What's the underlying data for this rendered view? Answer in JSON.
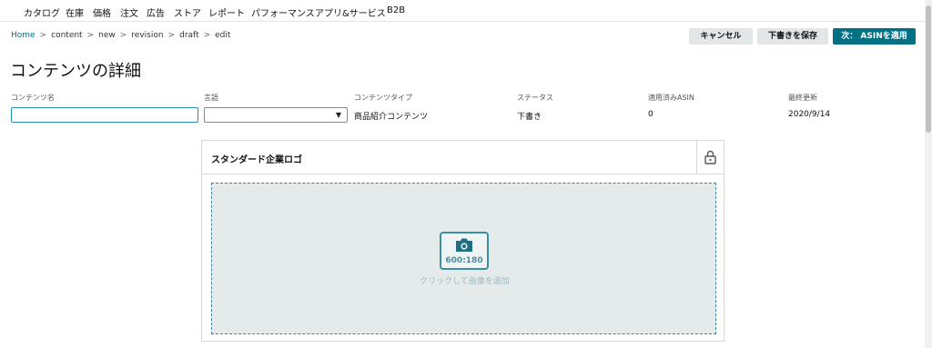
{
  "topnav": {
    "items": [
      "カタログ",
      "在庫",
      "価格",
      "注文",
      "広告",
      "ストア",
      "レポート",
      "パフォーマンス",
      "アプリ&サービス",
      "B2B"
    ]
  },
  "breadcrumb": {
    "items": [
      "Home",
      "content",
      "new",
      "revision",
      "draft",
      "edit"
    ],
    "separator": ">"
  },
  "actions": {
    "cancel": "キャンセル",
    "save_draft": "下書きを保存",
    "next": "次： ASINを適用"
  },
  "page_title": "コンテンツの詳細",
  "fields": {
    "content_name": {
      "label": "コンテンツ名",
      "value": "",
      "placeholder": ""
    },
    "language": {
      "label": "言語",
      "value": ""
    },
    "content_type": {
      "label": "コンテンツタイプ",
      "value": "商品紹介コンテンツ"
    },
    "status": {
      "label": "ステータス",
      "value": "下書き"
    },
    "applied_asin": {
      "label": "適用済みASIN",
      "value": "0"
    },
    "last_updated": {
      "label": "最終更新",
      "value": "2020/9/14"
    }
  },
  "module": {
    "title": "スタンダード企業ロゴ",
    "image_ratio": "600:180",
    "upload_hint": "クリックして画像を追加"
  },
  "icons": {
    "lock": "lock-icon",
    "camera": "camera-icon",
    "dropdown": "chevron-down-icon"
  },
  "colors": {
    "accent": "#007185",
    "input_focus": "#2a8fb5",
    "dropzone_bg": "#e5ebeb",
    "dropzone_border": "#3a86a5"
  }
}
